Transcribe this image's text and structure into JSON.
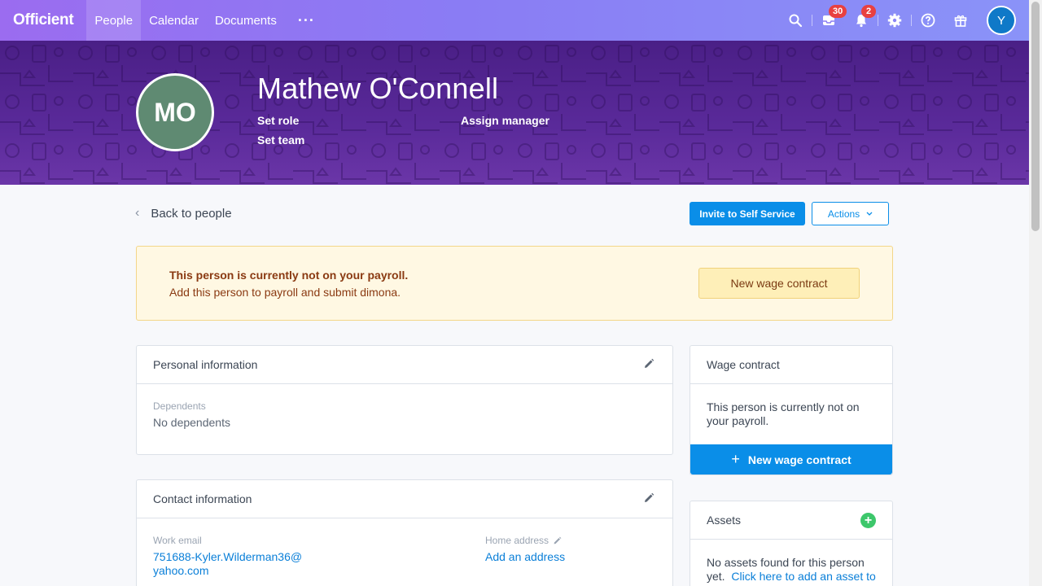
{
  "nav": {
    "brand": "Officient",
    "items": [
      {
        "label": "People",
        "active": true
      },
      {
        "label": "Calendar",
        "active": false
      },
      {
        "label": "Documents",
        "active": false
      }
    ],
    "more": "···",
    "inbox_badge": "30",
    "notif_badge": "2",
    "user_initial": "Y",
    "accent": "#9b6cf0"
  },
  "hero": {
    "initials": "MO",
    "name": "Mathew O'Connell",
    "set_role": "Set role",
    "set_team": "Set team",
    "assign_manager": "Assign manager"
  },
  "toolbar": {
    "back": "Back to people",
    "invite": "Invite to Self Service",
    "actions": "Actions"
  },
  "alert": {
    "title": "This person is currently not on your payroll.",
    "text": "Add this person to payroll and submit dimona.",
    "button": "New wage contract"
  },
  "personal": {
    "title": "Personal information",
    "dependents_label": "Dependents",
    "dependents_value": "No dependents"
  },
  "contact": {
    "title": "Contact information",
    "work_email_label": "Work email",
    "work_email_line1": "751688-Kyler.Wilderman36@",
    "work_email_line2": "yahoo.com",
    "home_address_label": "Home address",
    "home_address_link": "Add an address"
  },
  "wage": {
    "title": "Wage contract",
    "text_line1": "This person is currently not on",
    "text_line2": "your payroll.",
    "button": "New wage contract"
  },
  "assets": {
    "title": "Assets",
    "text_line1": "No assets found for this person",
    "text_line2": "yet.",
    "link": "Click here to add an asset to"
  }
}
